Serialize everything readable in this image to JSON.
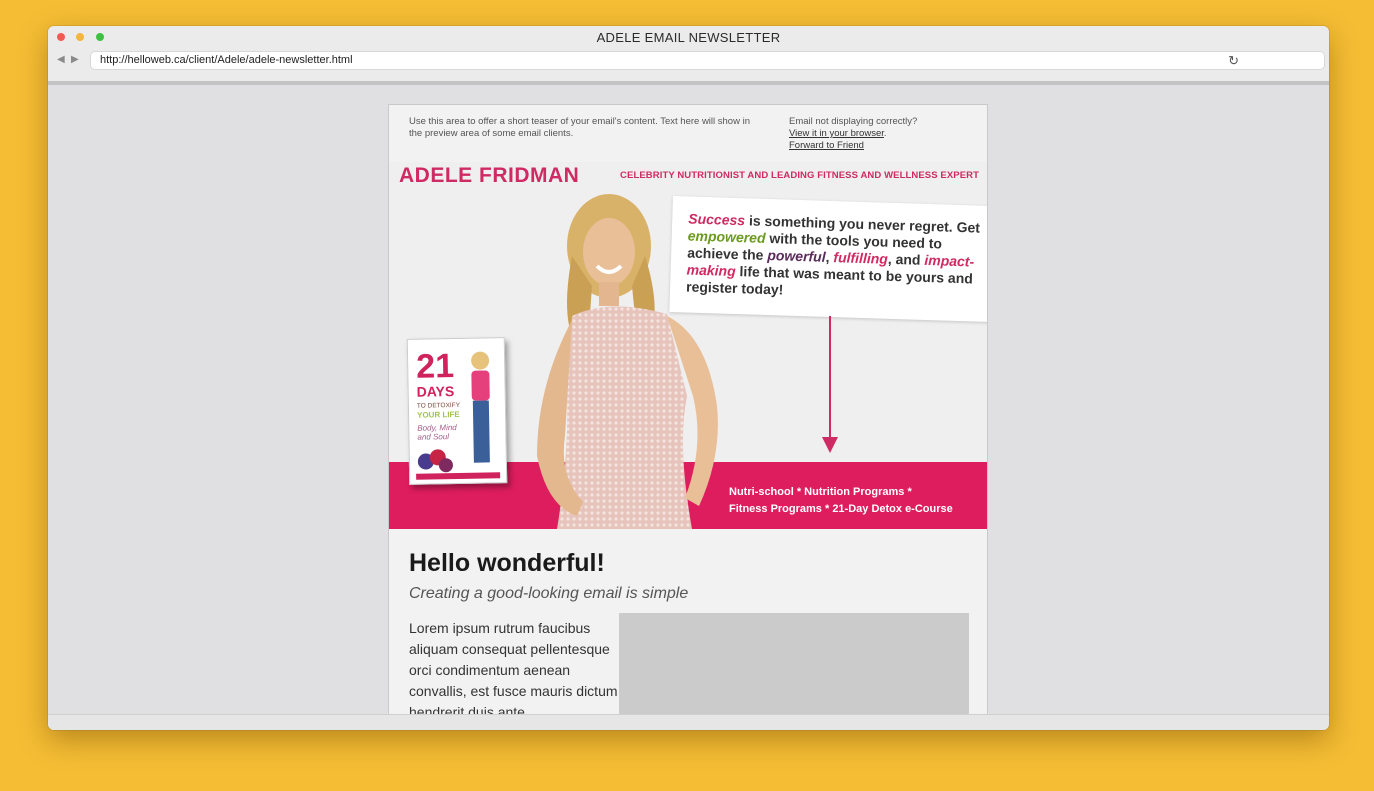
{
  "window": {
    "title": "ADELE EMAIL NEWSLETTER",
    "url": "http://helloweb.ca/client/Adele/adele-newsletter.html",
    "nav_back": "◀",
    "nav_forward": "▶",
    "reload_icon": "↻"
  },
  "email": {
    "preheader": {
      "teaser": "Use this area to offer a short teaser of your email's content. Text here will show in the preview area of some email clients.",
      "display_issue": "Email not displaying correctly?",
      "view_in_browser": "View it in your browser",
      "view_suffix": ".",
      "forward": "Forward to Friend"
    },
    "hero": {
      "brand": "ADELE FRIDMAN",
      "tagline": "CELEBRITY NUTRITIONIST AND LEADING FITNESS AND WELLNESS EXPERT",
      "quote": {
        "w1": "Success",
        "t1": " is something you never regret.",
        "t2": "Get ",
        "w2": "empowered",
        "t3": " with the tools you need to achieve the ",
        "w3": "powerful",
        "t4": ", ",
        "w4": "fulfilling",
        "t5": ", and ",
        "w5": "impact-making",
        "t6": " life that was meant to be yours and register today!"
      },
      "book": {
        "number": "21",
        "days": "DAYS",
        "line1": "TO DETOXIFY",
        "line2": "YOUR LIFE",
        "line3": "Body, Mind and Soul"
      },
      "band_line1": "Nutri-school * Nutrition Programs *",
      "band_line2": "Fitness Programs * 21-Day Detox e-Course"
    },
    "body": {
      "heading": "Hello wonderful!",
      "subheading": "Creating a good-looking email is simple",
      "paragraph": "Lorem ipsum rutrum faucibus aliquam consequat pellentesque orci condimentum aenean convallis, est fusce mauris dictum hendrerit duis ante"
    }
  },
  "colors": {
    "background": "#F5BD34",
    "brand_pink": "#DD1D5E",
    "accent_green": "#6B9A1F"
  }
}
